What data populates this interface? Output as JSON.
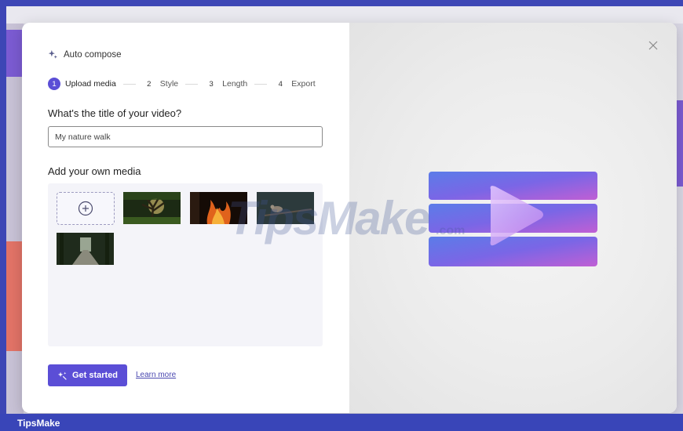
{
  "auto_compose": {
    "title": "Auto compose",
    "icon": "sparkle-icon"
  },
  "steps": [
    {
      "number": "1",
      "label": "Upload media"
    },
    {
      "number": "2",
      "label": "Style"
    },
    {
      "number": "3",
      "label": "Length"
    },
    {
      "number": "4",
      "label": "Export"
    }
  ],
  "title_section": {
    "question": "What's the title of your video?",
    "value": "My nature walk"
  },
  "media_section": {
    "heading": "Add your own media",
    "items": [
      {
        "icon": "forest-tree-image"
      },
      {
        "icon": "campfire-image"
      },
      {
        "icon": "bird-branch-image"
      },
      {
        "icon": "forest-path-image"
      }
    ]
  },
  "actions": {
    "get_started": "Get started",
    "learn_more": "Learn more"
  },
  "watermark": {
    "brand": "TipsMake",
    "suffix": ".com"
  },
  "footer": {
    "brand": "TipsMake"
  },
  "colors": {
    "accent": "#5b4ed6",
    "footer": "#3945b8"
  }
}
